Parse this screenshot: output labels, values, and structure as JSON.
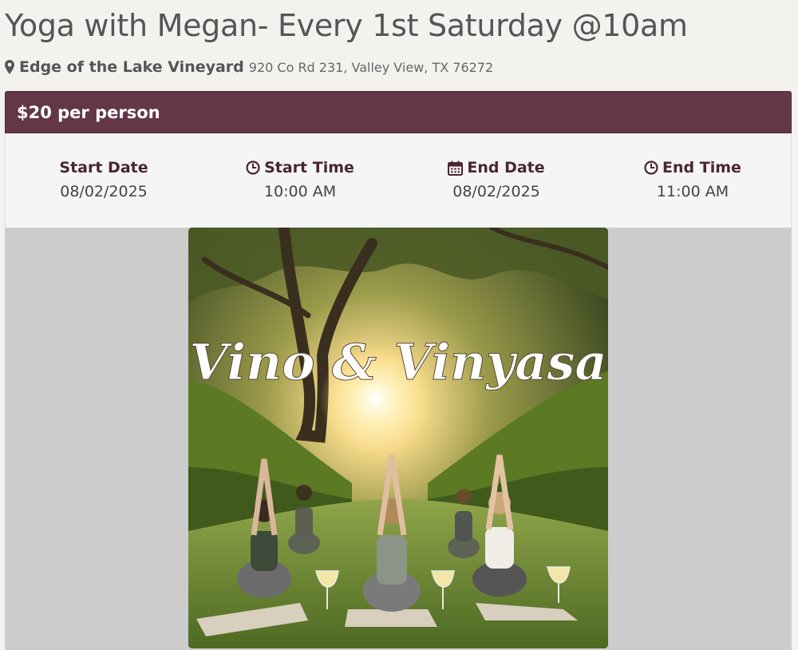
{
  "event": {
    "title": "Yoga with Megan- Every 1st Saturday @10am",
    "venue_name": "Edge of the Lake Vineyard",
    "venue_address": "920 Co Rd 231, Valley View, TX 76272",
    "price": "$20 per person"
  },
  "details": {
    "start_date_label": "Start Date",
    "start_date": "08/02/2025",
    "start_time_label": "Start Time",
    "start_time": "10:00 AM",
    "end_date_label": "End Date",
    "end_date": "08/02/2025",
    "end_time_label": "End Time",
    "end_time": "11:00 AM"
  },
  "image": {
    "lettering": "Vino & Vinyasa",
    "icon": "map-marker-icon"
  },
  "colors": {
    "price_bar": "#633747",
    "label_text": "#4a2533",
    "title_text": "#555555",
    "image_backdrop": "#cccccc"
  }
}
